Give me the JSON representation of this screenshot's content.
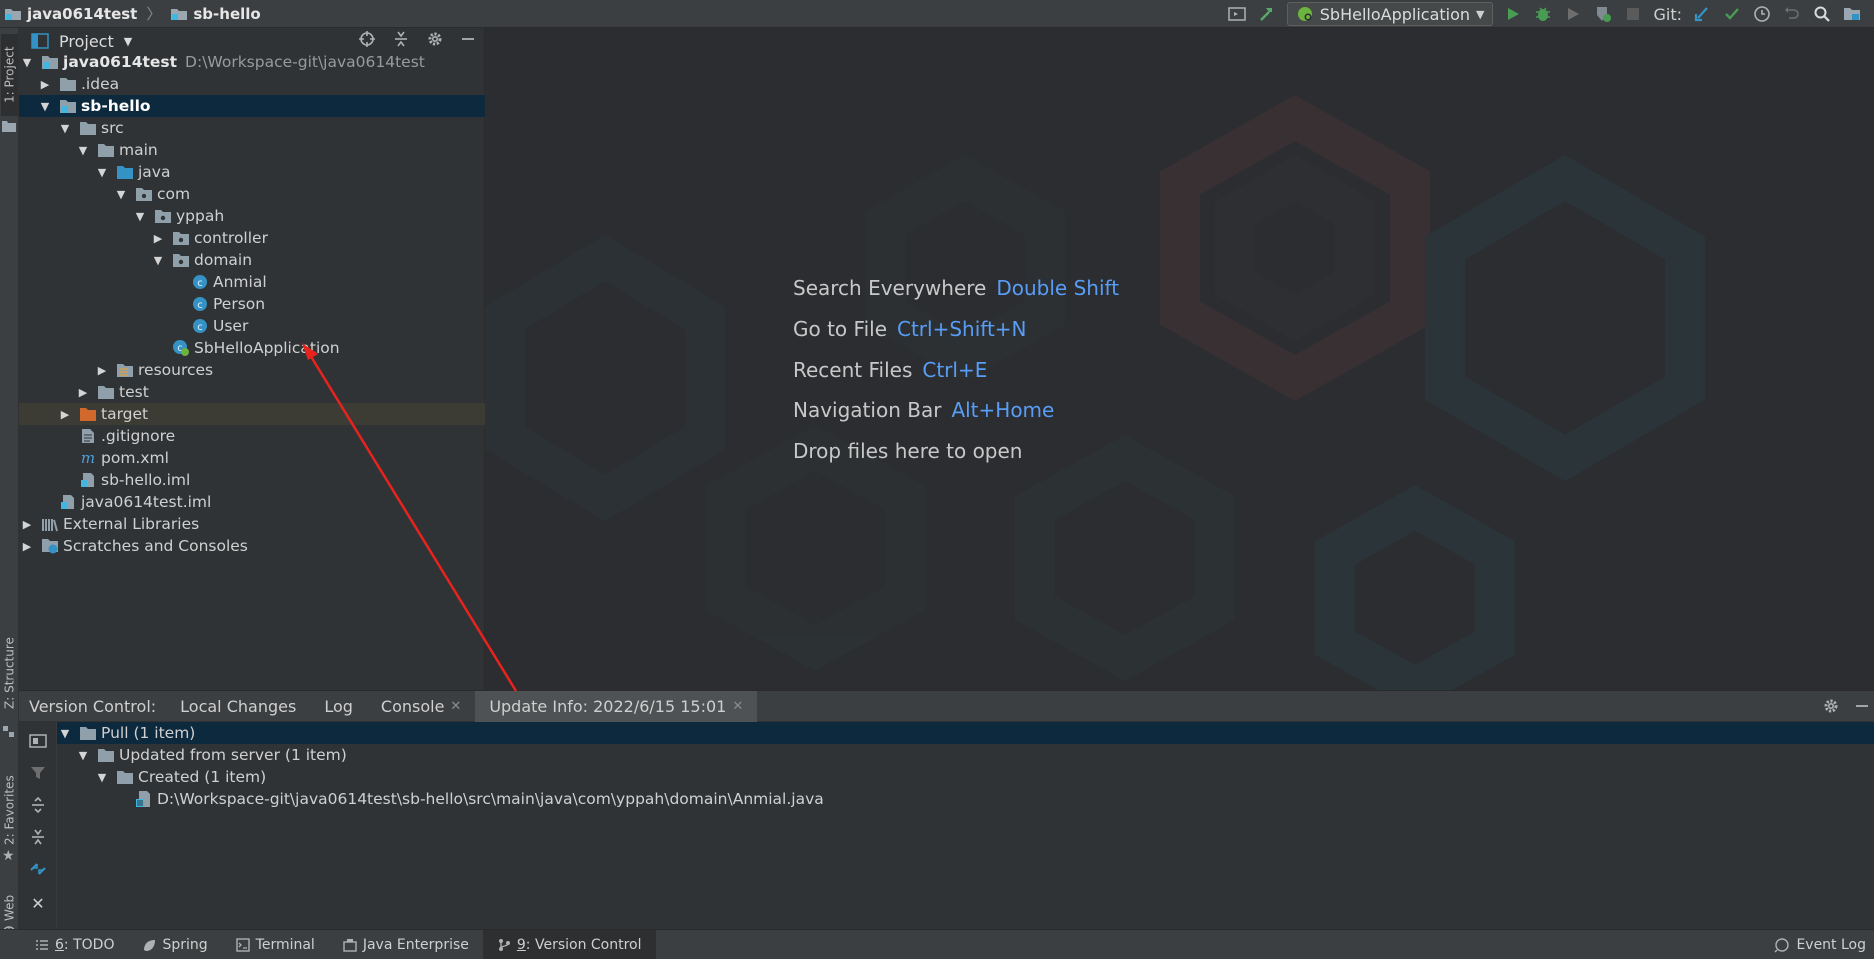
{
  "breadcrumb": {
    "project": "java0614test",
    "module": "sb-hello"
  },
  "toolbar": {
    "run_config": "SbHelloApplication",
    "git_label": "Git:"
  },
  "left_strip": {
    "project_tab": "1: Project",
    "structure_tab": "Z: Structure",
    "favorites_tab": "2: Favorites",
    "web_tab": "Web"
  },
  "project_panel": {
    "title": "Project",
    "tree": [
      {
        "label": "java0614test",
        "path": "D:\\Workspace-git\\java0614test",
        "bold": true,
        "arrow": "▼",
        "icon": "module-folder-icon"
      },
      {
        "label": ".idea",
        "arrow": "▶",
        "icon": "folder-icon"
      },
      {
        "label": "sb-hello",
        "arrow": "▼",
        "icon": "module-folder-icon",
        "selected": true
      },
      {
        "label": "src",
        "arrow": "▼",
        "icon": "folder-icon"
      },
      {
        "label": "main",
        "arrow": "▼",
        "icon": "folder-icon"
      },
      {
        "label": "java",
        "arrow": "▼",
        "icon": "source-folder-icon"
      },
      {
        "label": "com",
        "arrow": "▼",
        "icon": "package-icon"
      },
      {
        "label": "yppah",
        "arrow": "▼",
        "icon": "package-icon"
      },
      {
        "label": "controller",
        "arrow": "▶",
        "icon": "package-icon"
      },
      {
        "label": "domain",
        "arrow": "▼",
        "icon": "package-icon"
      },
      {
        "label": "Anmial",
        "arrow": "",
        "icon": "class-icon"
      },
      {
        "label": "Person",
        "arrow": "",
        "icon": "class-icon"
      },
      {
        "label": "User",
        "arrow": "",
        "icon": "class-icon"
      },
      {
        "label": "SbHelloApplication",
        "arrow": "",
        "icon": "spring-boot-class-icon"
      },
      {
        "label": "resources",
        "arrow": "▶",
        "icon": "resources-folder-icon"
      },
      {
        "label": "test",
        "arrow": "▶",
        "icon": "folder-icon"
      },
      {
        "label": "target",
        "arrow": "▶",
        "icon": "excluded-folder-icon",
        "ignored": true
      },
      {
        "label": ".gitignore",
        "arrow": "",
        "icon": "file-icon"
      },
      {
        "label": "pom.xml",
        "arrow": "",
        "icon": "maven-icon"
      },
      {
        "label": "sb-hello.iml",
        "arrow": "",
        "icon": "iml-file-icon"
      },
      {
        "label": "java0614test.iml",
        "arrow": "",
        "icon": "iml-file-icon"
      },
      {
        "label": "External Libraries",
        "arrow": "▶",
        "icon": "libraries-icon"
      },
      {
        "label": "Scratches and Consoles",
        "arrow": "▶",
        "icon": "scratches-icon"
      }
    ]
  },
  "editor_hints": [
    {
      "label": "Search Everywhere",
      "key": "Double Shift"
    },
    {
      "label": "Go to File",
      "key": "Ctrl+Shift+N"
    },
    {
      "label": "Recent Files",
      "key": "Ctrl+E"
    },
    {
      "label": "Navigation Bar",
      "key": "Alt+Home"
    },
    {
      "label": "Drop files here to open",
      "key": ""
    }
  ],
  "version_control": {
    "title": "Version Control:",
    "tabs": [
      "Local Changes",
      "Log",
      "Console",
      "Update Info: 2022/6/15 15:01"
    ],
    "tree": [
      {
        "label": "Pull (1 item)",
        "arrow": "▼",
        "icon": "folder-icon",
        "selected": true
      },
      {
        "label": "Updated from server (1 item)",
        "arrow": "▼",
        "icon": "folder-icon"
      },
      {
        "label": "Created (1 item)",
        "arrow": "▼",
        "icon": "folder-icon"
      },
      {
        "label": "D:\\Workspace-git\\java0614test\\sb-hello\\src\\main\\java\\com\\yppah\\domain\\Anmial.java",
        "arrow": "",
        "icon": "java-file-icon"
      }
    ]
  },
  "bottom_tabs": [
    {
      "num": "6",
      "label": ": TODO",
      "icon": "todo-icon"
    },
    {
      "num": "",
      "label": "Spring",
      "icon": "spring-icon"
    },
    {
      "num": "",
      "label": "Terminal",
      "icon": "terminal-icon"
    },
    {
      "num": "",
      "label": "Java Enterprise",
      "icon": "java-enterprise-icon"
    },
    {
      "num": "9",
      "label": ": Version Control",
      "icon": "version-control-icon"
    }
  ],
  "event_log": "Event Log",
  "colors": {
    "accent_blue": "#589df6",
    "selection": "#0d293e",
    "annotation_red": "#e8231e"
  }
}
